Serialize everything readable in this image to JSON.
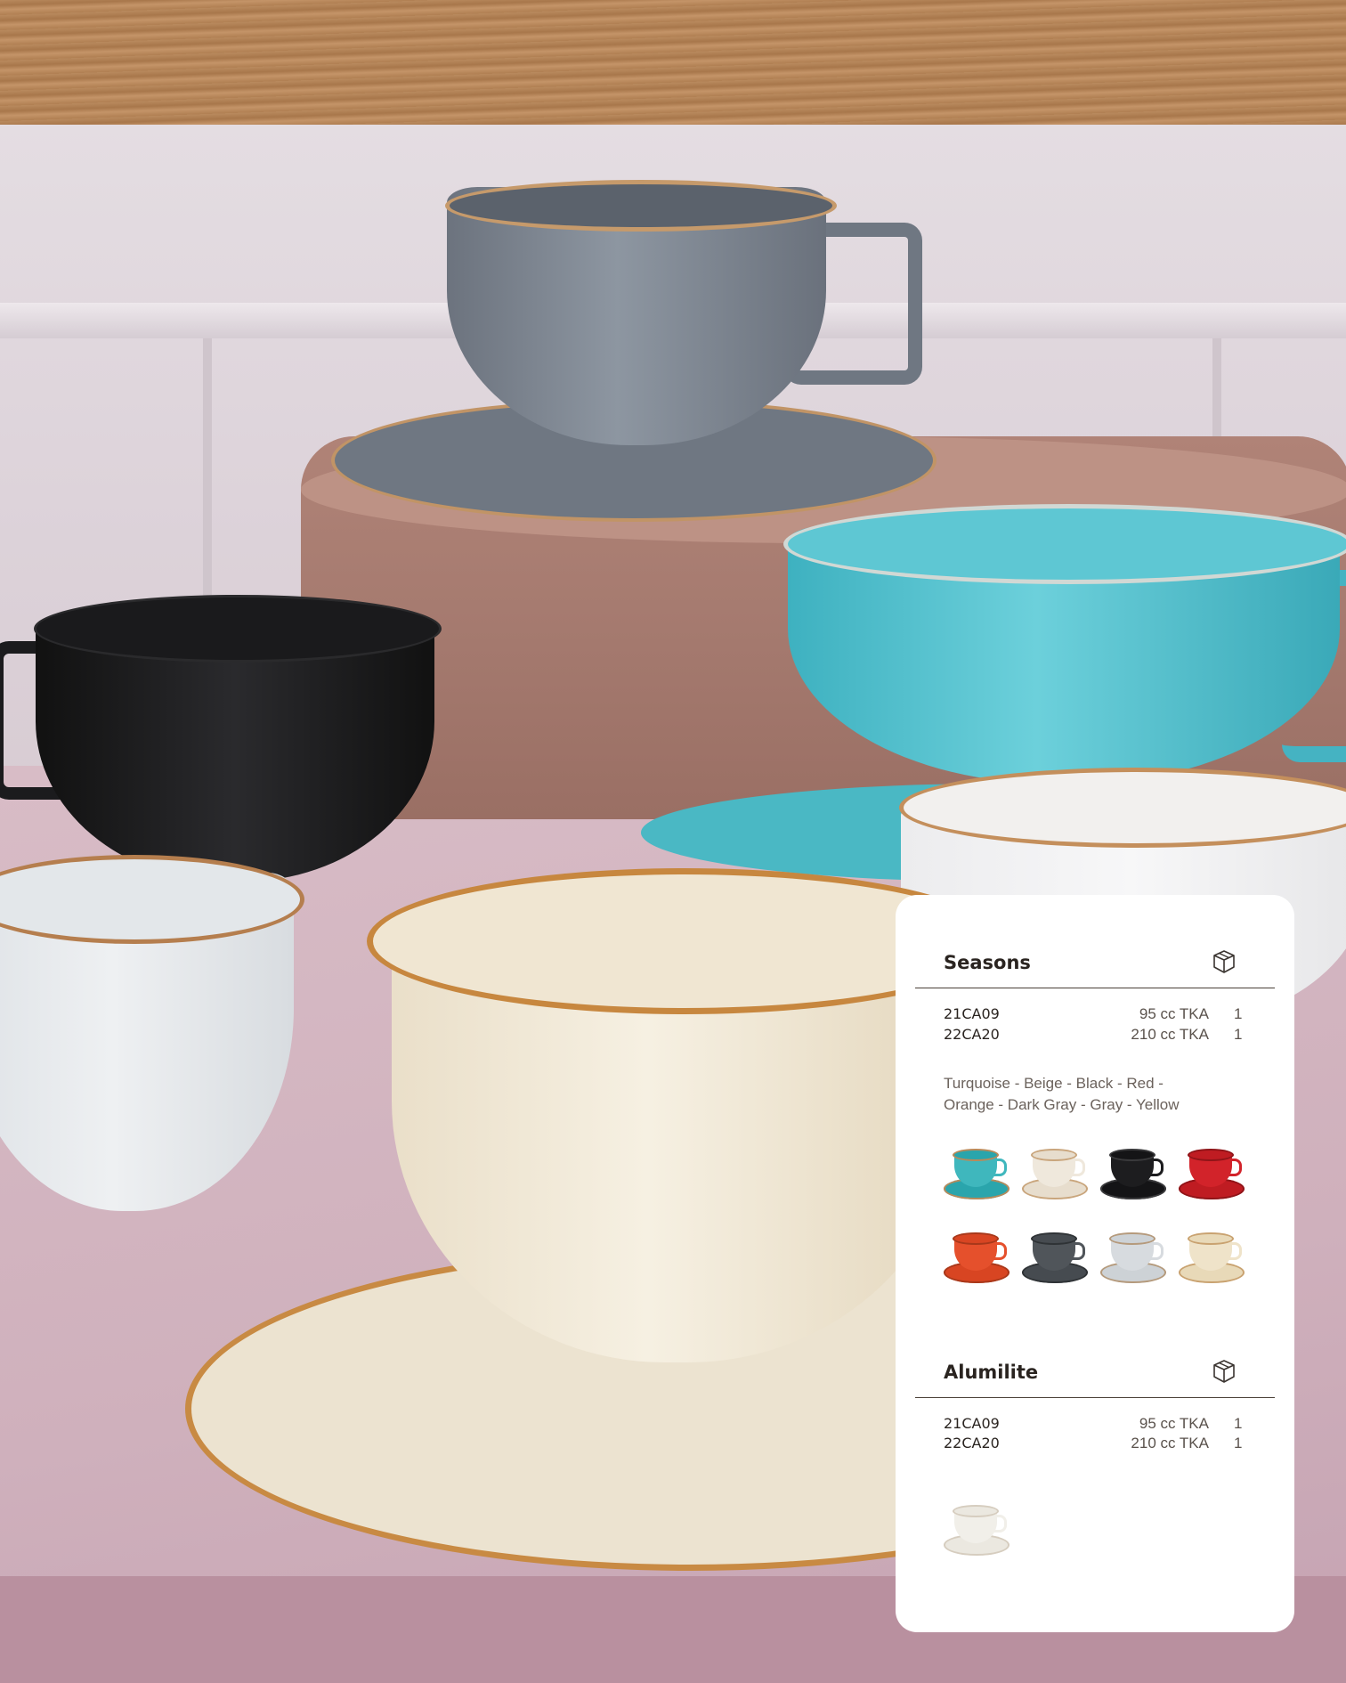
{
  "sections": [
    {
      "title": "Seasons",
      "rows": [
        {
          "code": "21CA09",
          "capacity": "95 cc TKA",
          "qty": "1"
        },
        {
          "code": "22CA20",
          "capacity": "210 cc TKA",
          "qty": "1"
        }
      ],
      "colors_line1": "Turquoise - Beige - Black - Red -",
      "colors_line2": "Orange - Dark Gray - Gray - Yellow",
      "swatches": [
        {
          "name": "turquoise",
          "body": "#3fb7bd",
          "saucer": "#2aa5ac",
          "rim": "#b98a5a"
        },
        {
          "name": "beige",
          "body": "#efe8dc",
          "saucer": "#e7ddcd",
          "rim": "#c9a57c"
        },
        {
          "name": "black",
          "body": "#1d1d1f",
          "saucer": "#141416",
          "rim": "#3a3a3c"
        },
        {
          "name": "red",
          "body": "#d2232a",
          "saucer": "#bf1c22",
          "rim": "#8f1418"
        },
        {
          "name": "orange",
          "body": "#e5502c",
          "saucer": "#d84522",
          "rim": "#a8381a"
        },
        {
          "name": "dark-gray",
          "body": "#50555a",
          "saucer": "#464b50",
          "rim": "#2f3336"
        },
        {
          "name": "gray",
          "body": "#d7dbdf",
          "saucer": "#cdd2d6",
          "rim": "#b59a7c"
        },
        {
          "name": "yellow",
          "body": "#efe3c9",
          "saucer": "#e8d9b8",
          "rim": "#c9a270"
        }
      ]
    },
    {
      "title": "Alumilite",
      "rows": [
        {
          "code": "21CA09",
          "capacity": "95 cc TKA",
          "qty": "1"
        },
        {
          "code": "22CA20",
          "capacity": "210 cc TKA",
          "qty": "1"
        }
      ],
      "swatches": [
        {
          "name": "white",
          "body": "#f1efe9",
          "saucer": "#ebe8e0",
          "rim": "#d6cdbf"
        }
      ]
    }
  ]
}
